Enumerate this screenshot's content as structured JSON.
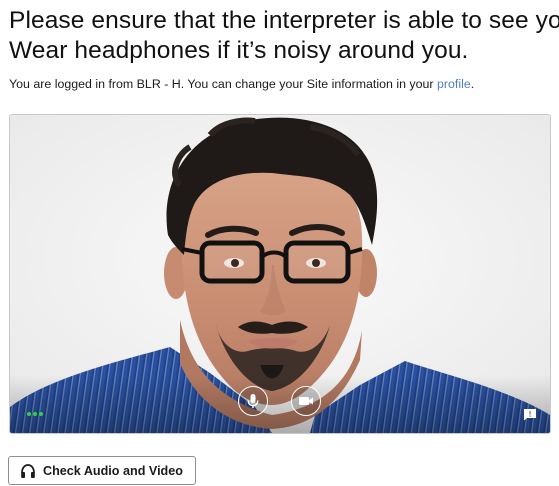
{
  "instructions": {
    "line1": "Please ensure that the interpreter is able to see you.",
    "line2": "Wear headphones if it’s noisy around you."
  },
  "login": {
    "prefix": "You are logged in from BLR - H. You can change your Site information in your ",
    "link_text": "profile",
    "suffix": "."
  },
  "video": {
    "content": "user-camera-preview",
    "mic_icon": "microphone-icon",
    "camera_icon": "video-camera-icon",
    "chat_icon": "chat-icon",
    "signal_color": "#2fd14b"
  },
  "actions": {
    "check_label": "Check Audio and Video",
    "check_icon": "headphones-icon"
  },
  "colors": {
    "link": "#4f7fc7",
    "text": "#1b1b1b",
    "border": "#c9c9c9"
  }
}
